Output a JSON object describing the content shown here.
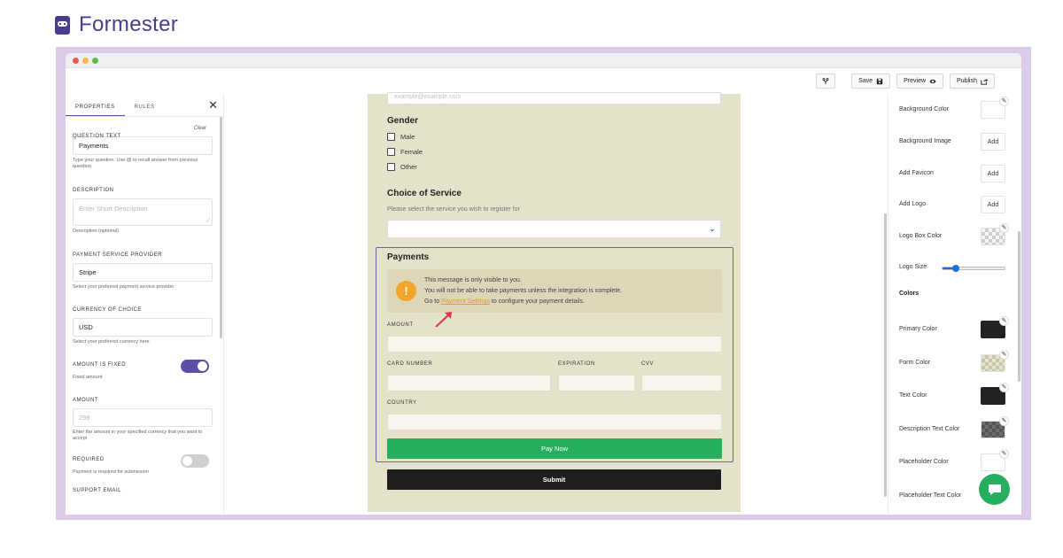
{
  "brand": {
    "name": "Formester"
  },
  "toolbar": {
    "save": "Save",
    "preview": "Preview",
    "publish": "Publish"
  },
  "left_panel": {
    "tabs": [
      "PROPERTIES",
      "RULES"
    ],
    "question_text": {
      "label": "QUESTION TEXT",
      "clear": "Clear",
      "value": "Payments",
      "hint": "Type your question. Use @ to recall answer from previous question"
    },
    "description": {
      "label": "DESCRIPTION",
      "placeholder": "Enter Short Description",
      "hint": "Description (optional)"
    },
    "provider": {
      "label": "PAYMENT SERVICE PROVIDER",
      "value": "Stripe",
      "hint": "Select your preferred payment service provider"
    },
    "currency": {
      "label": "CURRENCY OF CHOICE",
      "value": "USD",
      "hint": "Select your preferred currency here"
    },
    "amount_fixed": {
      "label": "AMOUNT IS FIXED",
      "hint": "Fixed amount",
      "on": true
    },
    "amount": {
      "label": "AMOUNT",
      "placeholder": "299",
      "hint": "Enter the amount in your specified currency that you want to accept"
    },
    "required": {
      "label": "REQUIRED",
      "hint": "Payment is required for submission",
      "on": false
    },
    "support_email": {
      "label": "SUPPORT EMAIL"
    }
  },
  "form": {
    "email_placeholder": "example@example.com",
    "gender": {
      "title": "Gender",
      "options": [
        "Male",
        "Female",
        "Other"
      ]
    },
    "service": {
      "title": "Choice of Service",
      "description": "Please select the service you wish to register for"
    },
    "payments": {
      "title": "Payments",
      "notice_line1": "This message is only visible to you.",
      "notice_line2": "You will not be able to take payments unless the integration is complete.",
      "notice_goto": "Go to",
      "notice_link": "Payment Settings",
      "notice_rest": "to configure your payment details.",
      "amount_label": "AMOUNT",
      "card_label": "CARD NUMBER",
      "expiration_label": "EXPIRATION",
      "cvv_label": "CVV",
      "country_label": "COUNTRY",
      "pay_button": "Pay Now"
    },
    "submit": "Submit"
  },
  "right_panel": {
    "background_color": "Background Color",
    "background_image": "Background Image",
    "add_favicon": "Add Favicon",
    "add_logo": "Add Logo",
    "logo_box_color": "Logo Box Color",
    "logo_size": "Logo Size",
    "logo_size_level": 0.15,
    "colors_heading": "Colors",
    "primary_color": "Primary Color",
    "form_color": "Form Color",
    "text_color": "Text Color",
    "description_text_color": "Description Text Color",
    "placeholder_color": "Placeholder Color",
    "placeholder_text_color": "Placeholder Text Color",
    "add_label": "Add"
  },
  "colors": {
    "accent": "#5e4ea6",
    "form_bg": "#e5e2cb",
    "pay_button": "#27ae5f",
    "submit_button": "#1e1e1e"
  }
}
